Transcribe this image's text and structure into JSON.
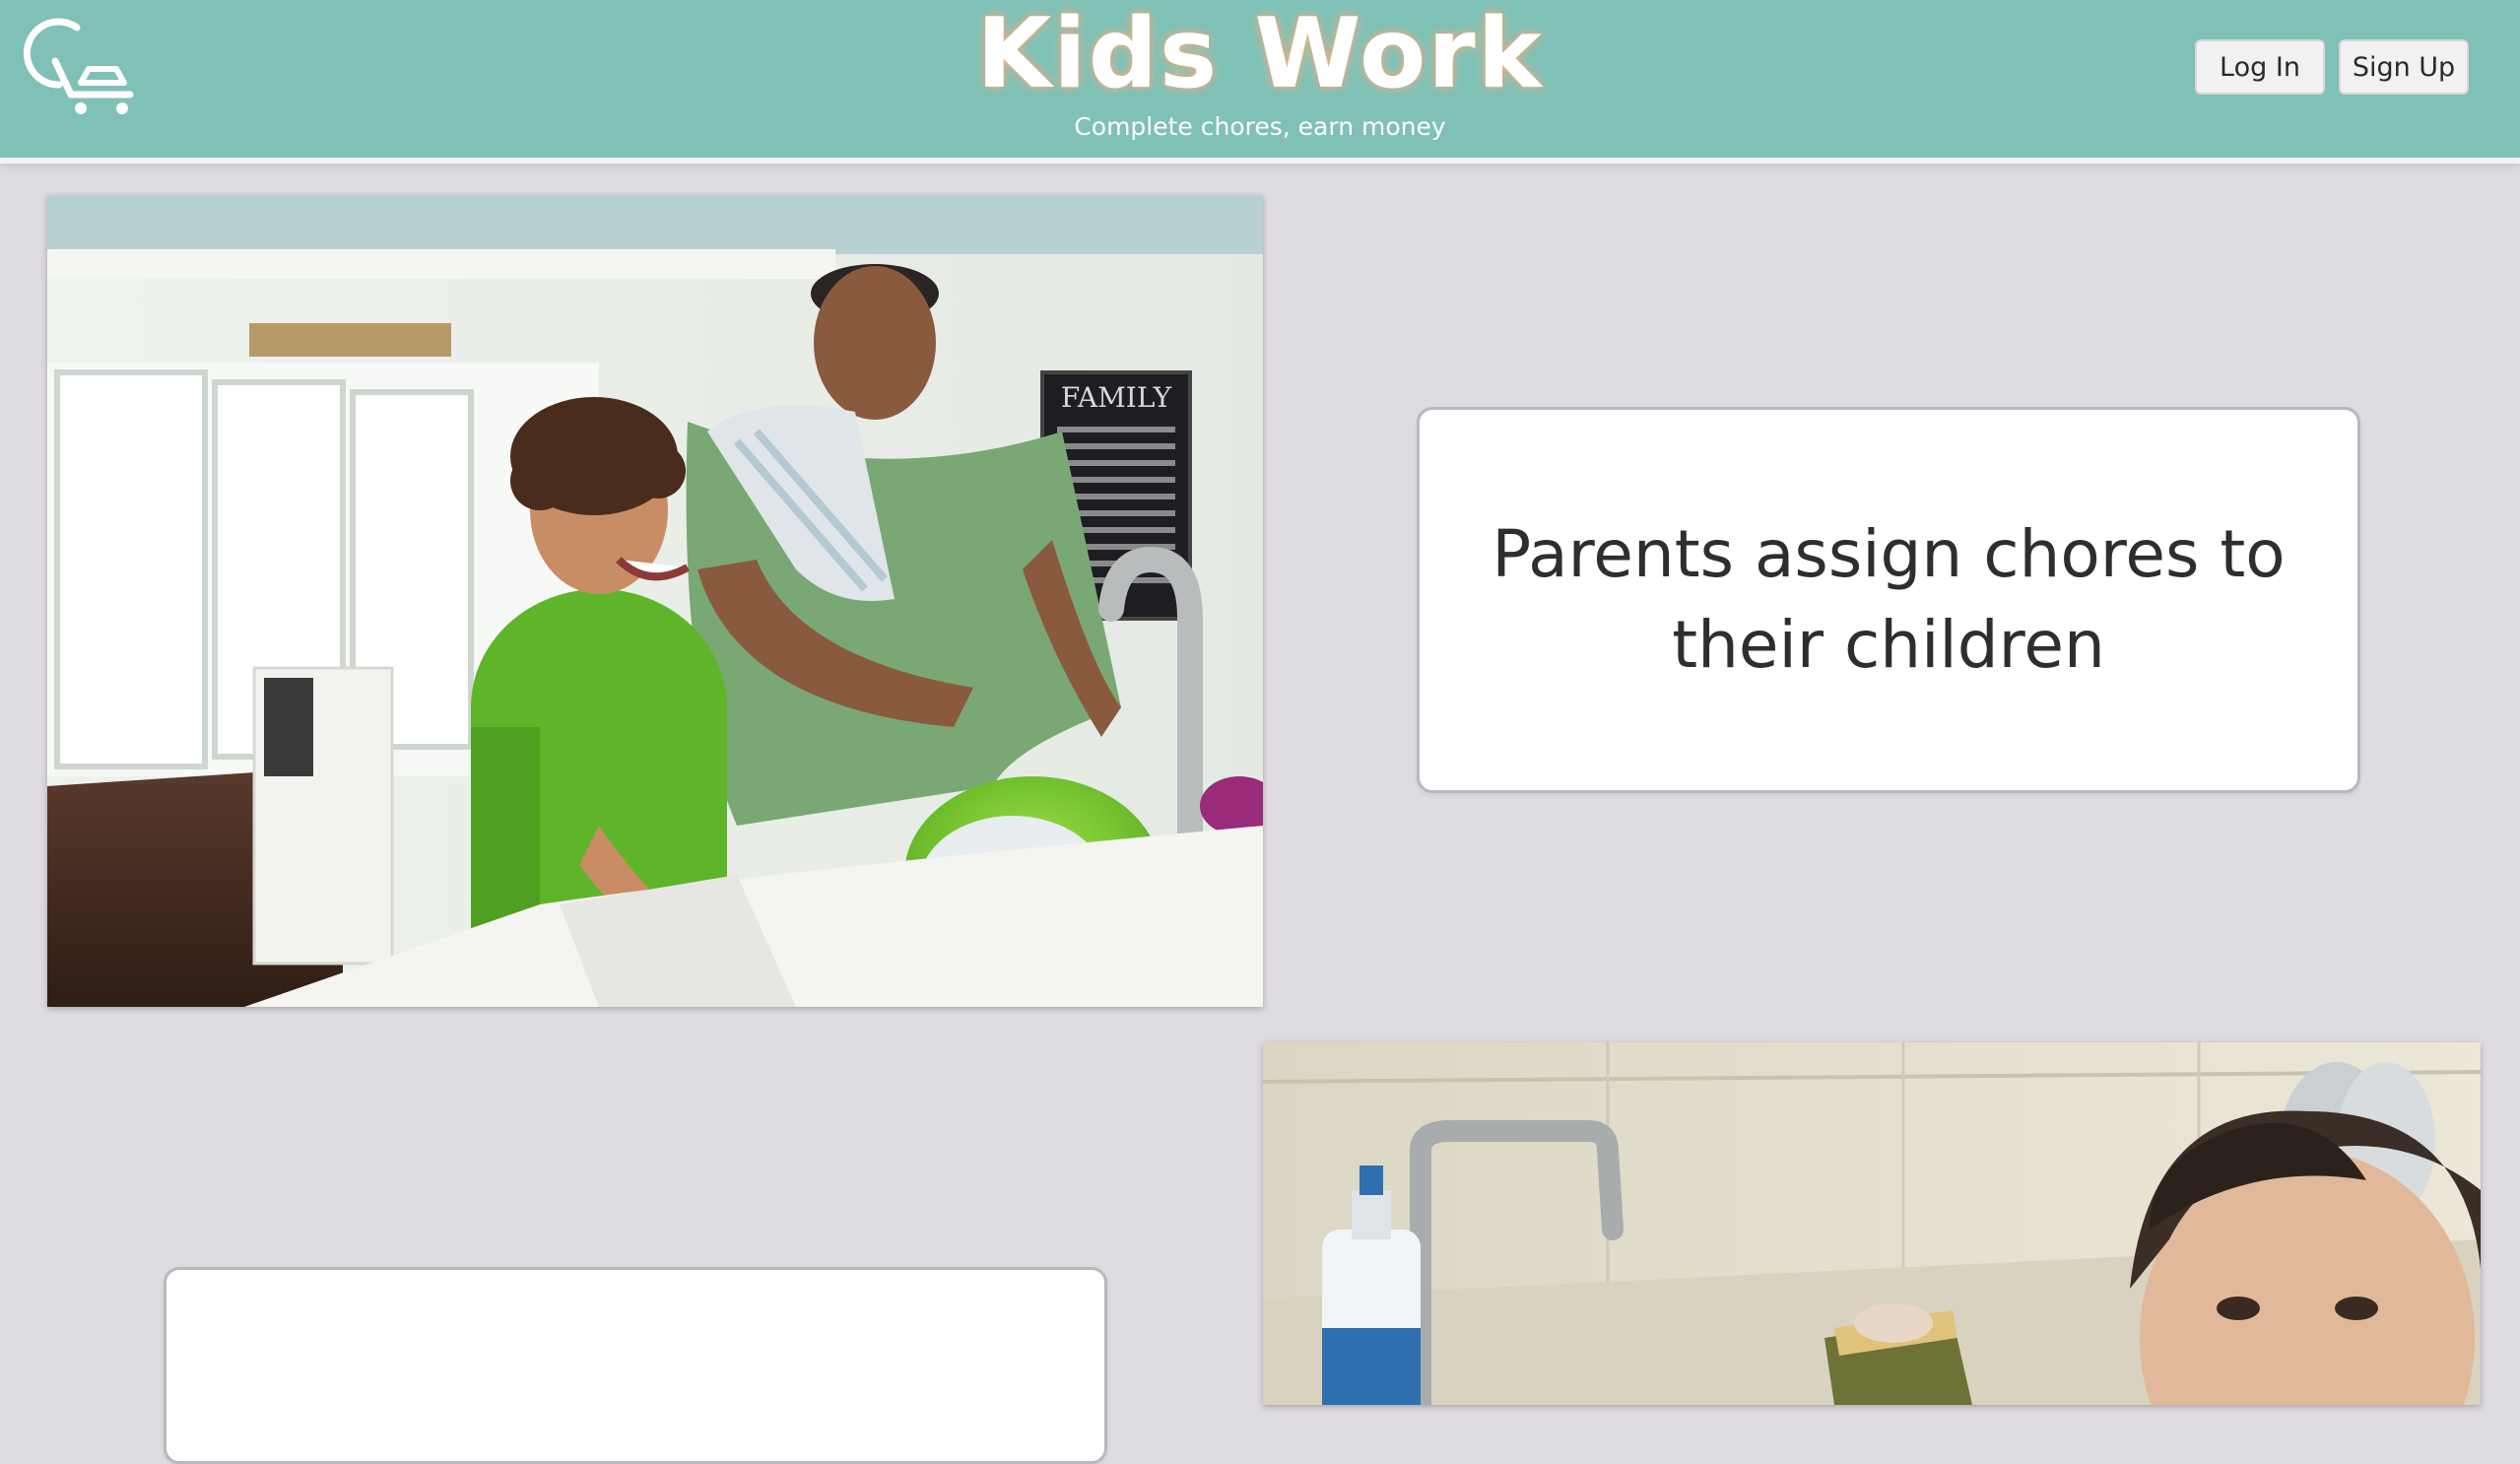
{
  "header": {
    "title": "Kids Work",
    "tagline": "Complete chores, earn money",
    "login_label": "Log In",
    "signup_label": "Sign Up",
    "logo_icon": "chore-cart-logo-icon",
    "background_color": "#7fc1b6"
  },
  "sections": [
    {
      "image_icon": "father-and-son-washing-dishes-photo",
      "card_text": "Parents assign chores to their children"
    },
    {
      "image_icon": "boy-scrubbing-dishes-photo",
      "card_text": ""
    }
  ]
}
